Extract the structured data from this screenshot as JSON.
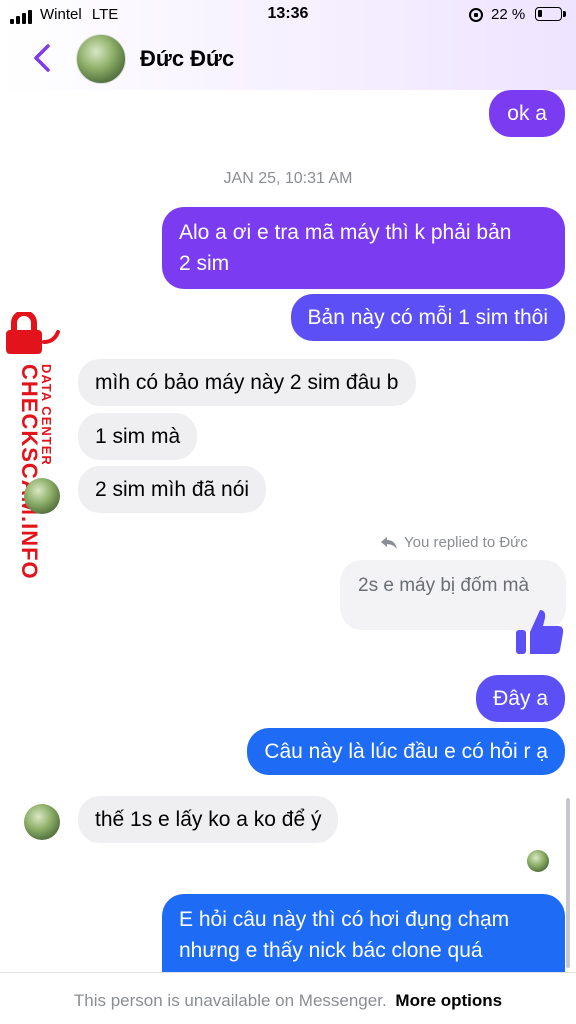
{
  "status_bar": {
    "carrier": "Wintel",
    "network": "LTE",
    "time": "13:36",
    "battery_percent": "22 %",
    "battery_level": 0.22,
    "icons": [
      "signal-icon",
      "rotation-lock-icon",
      "battery-icon"
    ]
  },
  "header": {
    "contact_name": "Đức Đức",
    "back_icon": "chevron-left-icon"
  },
  "colors": {
    "accent": "#7b3bf0",
    "outgoing_indigo": "#5b4ff5",
    "outgoing_blue": "#1e6cf5",
    "incoming": "#efeff1",
    "watermark": "#e3131b"
  },
  "watermark": {
    "brand": "CHECKSCAM.INFO",
    "tagline": "DATA CENTER"
  },
  "chat": {
    "messages": [
      {
        "from": "me",
        "text": "ok a"
      },
      {
        "type": "timestamp",
        "text": "JAN 25, 10:31 AM"
      },
      {
        "from": "me",
        "text_line1": "Alo a ơi e tra mã máy thì k phải bản",
        "text_line2": "2 sim"
      },
      {
        "from": "me",
        "text": "Bản này có mỗi 1 sim thôi"
      },
      {
        "from": "them",
        "text": "mìh có bảo máy này 2 sim đâu b"
      },
      {
        "from": "them",
        "text": "1 sim mà"
      },
      {
        "from": "them",
        "text": "2 sim mìh đã nói"
      },
      {
        "type": "reply_header",
        "text": "You replied to Đức"
      },
      {
        "type": "quoted",
        "text": "2s e máy bị đốm mà"
      },
      {
        "from": "me",
        "type": "like",
        "icon": "thumbs-up-icon"
      },
      {
        "from": "me",
        "text": "Đây a"
      },
      {
        "from": "me",
        "text": "Câu này là lúc đầu e có hỏi r ạ"
      },
      {
        "from": "them",
        "text": "thế 1s e lấy ko a ko để ý"
      },
      {
        "from": "me",
        "text_line1": "E hỏi câu này thì có hơi đụng chạm",
        "text_line2": "nhưng e thấy nick bác clone quá"
      }
    ]
  },
  "footer": {
    "message": "This person is unavailable on Messenger.",
    "more_options": "More options"
  }
}
